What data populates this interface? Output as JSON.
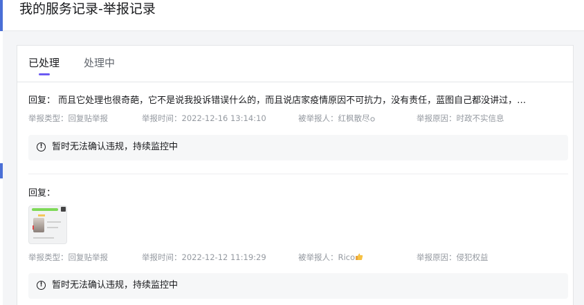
{
  "page": {
    "title": "我的服务记录-举报记录"
  },
  "tabs": [
    {
      "label": "已处理",
      "active": true
    },
    {
      "label": "处理中",
      "active": false
    }
  ],
  "labels": {
    "reply_prefix": "回复：",
    "report_type": "举报类型：",
    "report_time": "举报时间：",
    "reported_user": "被举报人：",
    "report_reason": "举报原因："
  },
  "records": [
    {
      "reply_text": "回复： 而且它处理也很奇葩，它不是说我投诉错误什么的，而且说店家疫情原因不可抗力，没有责任，蓝图自己都没讲过，…",
      "has_image": false,
      "report_type": "回复贴举报",
      "report_time": "2022-12-16 13:14:10",
      "reported_user": "红枫散尽",
      "reported_user_icon": "badge-icon",
      "report_reason": "时政不实信息",
      "result": "暂时无法确认违规，持续监控中",
      "result_icon": "info-circle-icon"
    },
    {
      "reply_text": "回复：",
      "has_image": true,
      "report_type": "回复贴举报",
      "report_time": "2022-12-12 11:19:29",
      "reported_user": "Rico",
      "reported_user_icon": "thumbs-up-emoji-icon",
      "report_reason": "侵犯权益",
      "result": "暂时无法确认违规，持续监控中",
      "result_icon": "info-circle-icon"
    }
  ],
  "colors": {
    "accent": "#6b5bf2",
    "text_primary": "#18191c",
    "text_secondary": "#9499a0",
    "result_bg": "#f6f7f8"
  }
}
